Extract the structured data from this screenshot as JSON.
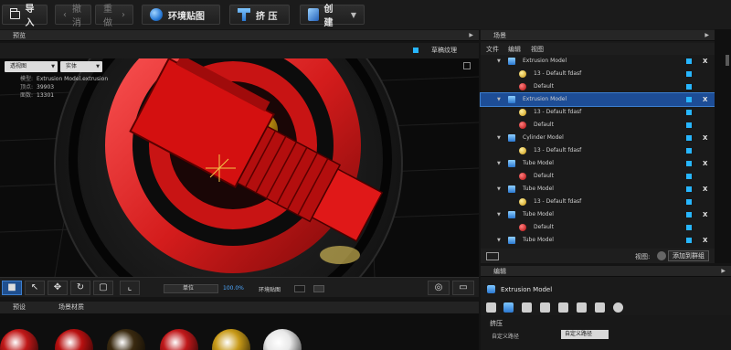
{
  "toolbar": {
    "import": "导入",
    "undo": "撤消",
    "redo": "重做",
    "env_map": "环境贴图",
    "extrude": "挤 压",
    "create": "创 建"
  },
  "preview": {
    "tab": "预览",
    "grass_texture": "草稿纹理",
    "view_mode": "透视图",
    "render_mode": "实体",
    "stats": [
      {
        "label": "模型:",
        "value": "Extrusion Model.extrusion"
      },
      {
        "label": "顶点:",
        "value": "39903"
      },
      {
        "label": "面数:",
        "value": "13301"
      }
    ],
    "unit": "单位",
    "zoom": "100.0%",
    "env_map_toggle": "环境贴图"
  },
  "library": {
    "tabs": [
      "预设",
      "场景材质"
    ],
    "swatch_colors": [
      "#c01818",
      "#b81010",
      "#3a2a10",
      "#c0181a",
      "#c89a18",
      "#e8e8e8"
    ]
  },
  "scene": {
    "title": "场景",
    "menu": [
      "文件",
      "编辑",
      "视图"
    ],
    "rows": [
      {
        "name": "Extrusion Model",
        "level": 0,
        "type": "model",
        "selected": false
      },
      {
        "name": "13 - Default fdasf",
        "level": 1,
        "type": "gold",
        "selected": false
      },
      {
        "name": "Default",
        "level": 1,
        "type": "red",
        "selected": false
      },
      {
        "name": "Extrusion Model",
        "level": 0,
        "type": "model",
        "selected": true
      },
      {
        "name": "13 - Default fdasf",
        "level": 1,
        "type": "gold",
        "selected": false
      },
      {
        "name": "Default",
        "level": 1,
        "type": "red",
        "selected": false
      },
      {
        "name": "Cylinder Model",
        "level": 0,
        "type": "cyl",
        "selected": false
      },
      {
        "name": "13 - Default fdasf",
        "level": 1,
        "type": "gold",
        "selected": false
      },
      {
        "name": "Tube Model",
        "level": 0,
        "type": "tube",
        "selected": false
      },
      {
        "name": "Default",
        "level": 1,
        "type": "red",
        "selected": false
      },
      {
        "name": "Tube Model",
        "level": 0,
        "type": "tube",
        "selected": false
      },
      {
        "name": "13 - Default fdasf",
        "level": 1,
        "type": "gold",
        "selected": false
      },
      {
        "name": "Tube Model",
        "level": 0,
        "type": "tube",
        "selected": false
      },
      {
        "name": "Default",
        "level": 1,
        "type": "red",
        "selected": false
      },
      {
        "name": "Tube Model",
        "level": 0,
        "type": "tube",
        "selected": false
      }
    ],
    "footer_view": "视图:",
    "add_to_group": "添加到群组"
  },
  "edit": {
    "title": "编辑",
    "model_name": "Extrusion Model",
    "section": "挤压",
    "field_label": "自定义路径",
    "field_value": "自定义路径"
  }
}
